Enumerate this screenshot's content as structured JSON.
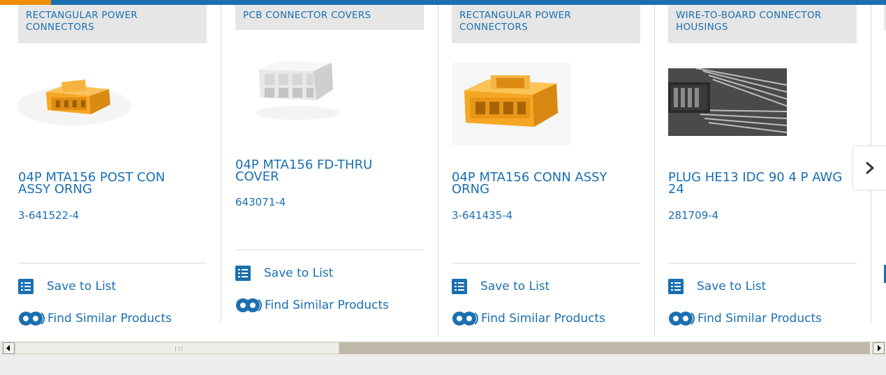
{
  "colors": {
    "link": "#1a6fb0",
    "accent": "#f28c00",
    "category_bg": "#e6e6e6"
  },
  "cards": [
    {
      "category": "RECTANGULAR POWER CONNECTORS",
      "title": "04P MTA156 POST CON ASSY ORNG",
      "part_number": "3-641522-4",
      "save_label": "Save to List",
      "similar_label": "Find Similar Products",
      "image": "orange-post-connector"
    },
    {
      "category": "PCB CONNECTOR COVERS",
      "title": "04P MTA156 FD-THRU COVER",
      "part_number": "643071-4",
      "save_label": "Save to List",
      "similar_label": "Find Similar Products",
      "image": "white-feed-thru-cover"
    },
    {
      "category": "RECTANGULAR POWER CONNECTORS",
      "title": "04P MTA156 CONN ASSY ORNG",
      "part_number": "3-641435-4",
      "save_label": "Save to List",
      "similar_label": "Find Similar Products",
      "image": "orange-conn-assy"
    },
    {
      "category": "WIRE-TO-BOARD CONNECTOR HOUSINGS",
      "title": "PLUG HE13 IDC 90 4 P AWG 24",
      "part_number": "281709-4",
      "save_label": "Save to List",
      "similar_label": "Find Similar Products",
      "image": "grayscale-idc-plug-photo"
    }
  ],
  "carousel": {
    "next_icon": "chevron-right-icon"
  },
  "scrollbar": {
    "left_icon": "arrow-left-icon",
    "right_icon": "arrow-right-icon"
  }
}
